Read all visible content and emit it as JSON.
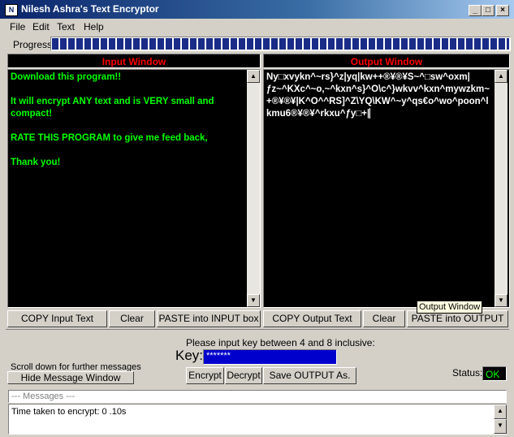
{
  "window": {
    "title": "Nilesh Ashra's Text Encryptor",
    "icon": "app-icon",
    "controls": {
      "minimize": "_",
      "maximize": "□",
      "close": "×"
    }
  },
  "menu": [
    "File",
    "Edit",
    "Text",
    "Help"
  ],
  "progress": {
    "label": "Progress:",
    "value": 1.0
  },
  "input_pane": {
    "header": "Input Window",
    "text": "Download this program!!\n\nIt will encrypt ANY text and is VERY small and compact!\n\nRATE THIS PROGRAM to give me feed back,\n\nThank you!"
  },
  "output_pane": {
    "header": "Output Window",
    "text": "Ny□xvykn^~rs}^z|yq|kw++®¥®¥S~^□sw^oxm|ƒz~^KXc^~o,~^kxn^s}^O\\c^}wkvv^kxn^mywzkm~+®¥®¥|K^O^^RS]^Z\\YQ\\KW^~y^qs€o^wo^poon^lkmu6®¥®¥^rkxu^ƒy□+|"
  },
  "buttons": {
    "copy_input": "COPY Input Text",
    "clear_input": "Clear",
    "paste_input": "PASTE into INPUT box",
    "copy_output": "COPY Output Text",
    "clear_output": "Clear",
    "paste_output": "PASTE into OUTPUT",
    "hide_messages": "Hide Message Window",
    "encrypt": "Encrypt",
    "decrypt": "Decrypt",
    "save_output": "Save OUTPUT As."
  },
  "tooltip": "Output Window",
  "key": {
    "prompt": "Please input key between 4 and 8 inclusive:",
    "label": "Key:",
    "value": "*******"
  },
  "scroll_note": "Scroll down for further messages",
  "status": {
    "label": "Status:",
    "value": "OK"
  },
  "messages": {
    "header": "--- Messages ---",
    "body": "Time taken to encrypt: 0 .10s"
  },
  "colors": {
    "title_start": "#0a246a",
    "title_end": "#a6caf0",
    "progress": "#1a2c88",
    "pane_bg": "#000000",
    "input_text": "#00ff00",
    "output_text": "#ffffff",
    "header_text": "#ff0000",
    "key_field": "#0000cc"
  }
}
